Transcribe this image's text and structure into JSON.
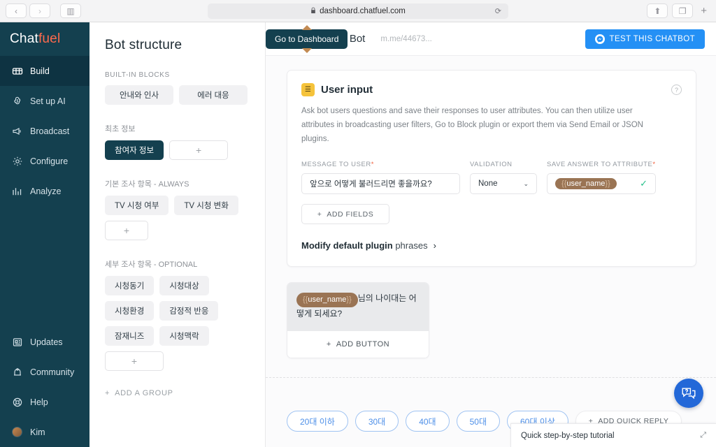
{
  "browser": {
    "back_label": "‹",
    "forward_label": "›",
    "sidebar_label": "▥",
    "url": "dashboard.chatfuel.com",
    "lock": "🔒",
    "reload_label": "⟳",
    "share_label": "⬆",
    "tabs_label": "❐",
    "newtab_label": "+"
  },
  "sidebar": {
    "brand_chat": "Chat",
    "brand_fuel": "fuel",
    "items": [
      {
        "label": "Build",
        "icon": "grid-icon",
        "active": true
      },
      {
        "label": "Set up AI",
        "icon": "brain-icon",
        "active": false
      },
      {
        "label": "Broadcast",
        "icon": "megaphone-icon",
        "active": false
      },
      {
        "label": "Configure",
        "icon": "gear-icon",
        "active": false
      },
      {
        "label": "Analyze",
        "icon": "bar-chart-icon",
        "active": false
      }
    ],
    "bottom_items": [
      {
        "label": "Updates",
        "icon": "news-icon"
      },
      {
        "label": "Community",
        "icon": "community-icon"
      },
      {
        "label": "Help",
        "icon": "lifebuoy-icon"
      },
      {
        "label": "Kim",
        "icon": "avatar-icon"
      }
    ]
  },
  "structure": {
    "title": "Bot structure",
    "groups": [
      {
        "label": "BUILT-IN BLOCKS",
        "style": "caps",
        "chips": [
          {
            "label": "안내와 인사",
            "type": "normal"
          },
          {
            "label": "에러 대응",
            "type": "normal"
          }
        ]
      },
      {
        "label": "최초 정보",
        "style": "ko",
        "chips": [
          {
            "label": "참여자 정보",
            "type": "active"
          },
          {
            "label": "+",
            "type": "add"
          }
        ]
      },
      {
        "label": "기본 조사 항목 - ALWAYS",
        "style": "ko",
        "chips": [
          {
            "label": "TV 시청 여부",
            "type": "normal"
          },
          {
            "label": "TV 시청 변화",
            "type": "normal"
          },
          {
            "label": "+",
            "type": "add"
          }
        ]
      },
      {
        "label": "세부 조사 항목 - OPTIONAL",
        "style": "ko",
        "chips": [
          {
            "label": "시청동기",
            "type": "normal"
          },
          {
            "label": "시청대상",
            "type": "normal"
          },
          {
            "label": "시청환경",
            "type": "normal"
          },
          {
            "label": "감정적 반응",
            "type": "normal"
          },
          {
            "label": "잠재니즈",
            "type": "normal"
          },
          {
            "label": "시청맥락",
            "type": "normal"
          },
          {
            "label": "+",
            "type": "add"
          }
        ]
      }
    ],
    "add_group_label": "ADD A GROUP",
    "add_group_plus": "+"
  },
  "topbar": {
    "tooltip": "Go to Dashboard",
    "bot_name": "st Bot",
    "bot_url": "m.me/44673...",
    "test_button": "TEST THIS CHATBOT"
  },
  "plugin_card": {
    "icon_glyph": "☰",
    "title": "User input",
    "help_glyph": "?",
    "description": "Ask bot users questions and save their responses to user attributes. You can then utilize user attributes in broadcasting user filters, Go to Block plugin or export them via Send Email or JSON plugins.",
    "fields": {
      "message_label": "MESSAGE TO USER",
      "message_required": "*",
      "message_value": "앞으로 어떻게 불러드리면 좋을까요?",
      "validation_label": "VALIDATION",
      "validation_value": "None",
      "validation_caret": "⌄",
      "attribute_label": "SAVE ANSWER TO ATTRIBUTE",
      "attribute_required": "*",
      "attribute_open": "{{",
      "attribute_value": "user_name",
      "attribute_close": "}}",
      "valid_check": "✓"
    },
    "add_fields_label": "ADD FIELDS",
    "add_fields_plus": "+",
    "modify_link_bold": "Modify",
    "modify_link_mid": " default plugin ",
    "modify_link_rest": "phrases",
    "modify_link_arrow": "›"
  },
  "bubble": {
    "attr_open": "{{",
    "attr_value": "user_name",
    "attr_close": "}}",
    "text": "님의 나이대는 어떻게 되세요?",
    "add_button_label": "ADD BUTTON",
    "add_button_plus": "+"
  },
  "quick_replies": {
    "items": [
      "20대 이하",
      "30대",
      "40대",
      "50대",
      "60대 이상"
    ],
    "add_label": "ADD QUICK REPLY",
    "add_plus": "+"
  },
  "tutorial": {
    "label": "Quick step-by-step tutorial",
    "expand_glyph": "⤢"
  },
  "colors": {
    "sidebar": "#14404f",
    "accent_orange": "#ff6a4d",
    "primary_blue": "#2490f5",
    "quick_reply_blue": "#4d8fe8",
    "attribute_brown": "#9a7454",
    "check_green": "#27c08a"
  }
}
